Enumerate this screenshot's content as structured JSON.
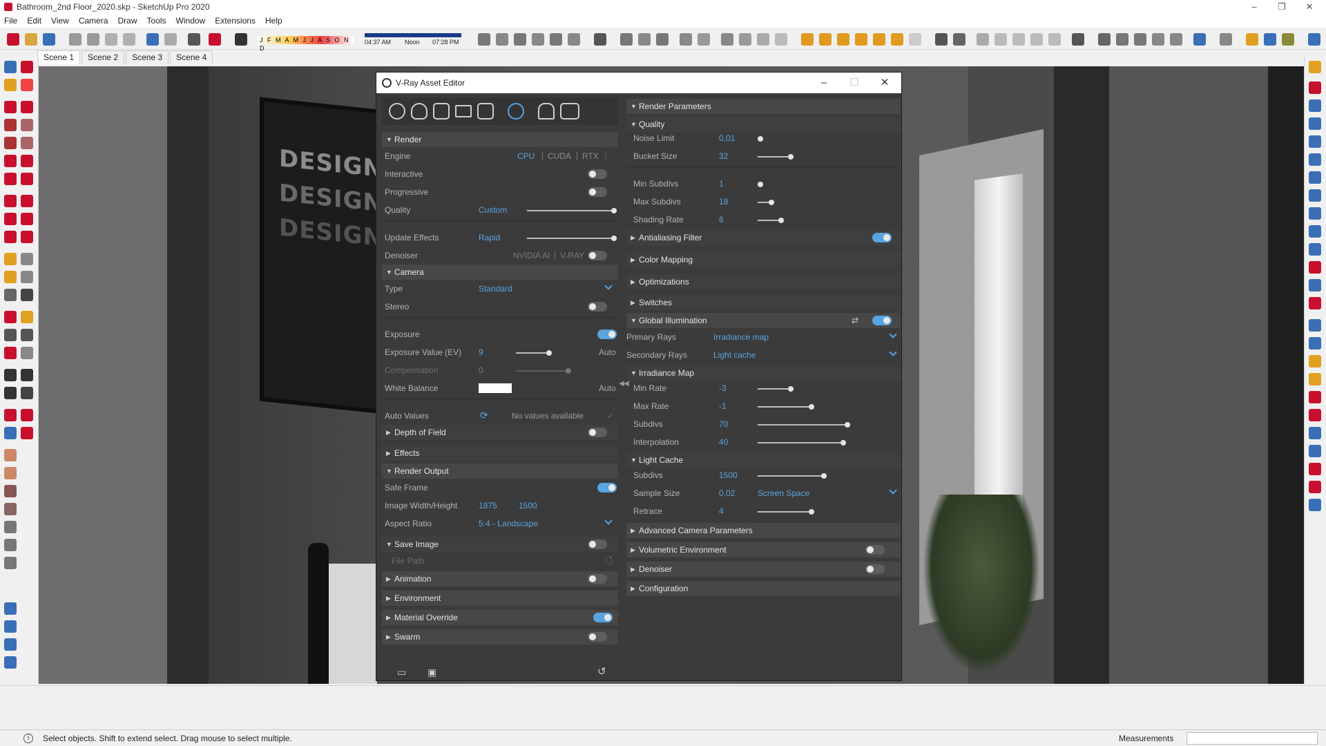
{
  "window": {
    "title": "Bathroom_2nd Floor_2020.skp - SketchUp Pro 2020"
  },
  "menu": [
    "File",
    "Edit",
    "View",
    "Camera",
    "Draw",
    "Tools",
    "Window",
    "Extensions",
    "Help"
  ],
  "shadow_bar": {
    "months": "J F M A M J J A S O N D",
    "time_start": "04:37 AM",
    "time_noon": "Noon",
    "time_end": "07:28 PM"
  },
  "scenes": [
    "Scene 1",
    "Scene 2",
    "Scene 3",
    "Scene 4"
  ],
  "viewport": {
    "poster_lines": [
      "DESIGN",
      "DESIGN",
      "DESIGN."
    ]
  },
  "status": {
    "info_icon": "i",
    "text": "Select objects. Shift to extend select. Drag mouse to select multiple.",
    "measurements_label": "Measurements"
  },
  "vray": {
    "title": "V-Ray Asset Editor",
    "render": {
      "header": "Render",
      "engine_label": "Engine",
      "engine_options": [
        "CPU",
        "CUDA",
        "RTX"
      ],
      "interactive_label": "Interactive",
      "interactive_on": false,
      "progressive_label": "Progressive",
      "progressive_on": false,
      "quality_label": "Quality",
      "quality_value": "Custom",
      "quality_fraction": 1.0,
      "update_effects_label": "Update Effects",
      "update_effects_value": "Rapid",
      "update_effects_fraction": 1.0,
      "denoiser_label": "Denoiser",
      "denoiser_nvidia": "NVIDIA AI",
      "denoiser_vray": "V-RAY",
      "denoiser_on": false
    },
    "camera": {
      "header": "Camera",
      "type_label": "Type",
      "type_value": "Standard",
      "stereo_label": "Stereo",
      "stereo_on": false,
      "exposure_label": "Exposure",
      "exposure_on": true,
      "ev_label": "Exposure Value (EV)",
      "ev_value": "9",
      "ev_auto": "Auto",
      "comp_label": "Compensation",
      "comp_value": "0",
      "wb_label": "White Balance",
      "wb_auto": "Auto",
      "wb_color": "#ffffff",
      "auto_values_label": "Auto Values",
      "auto_values_text": "No values available"
    },
    "dof_header": "Depth of Field",
    "effects_header": "Effects",
    "render_output": {
      "header": "Render Output",
      "safe_frame_label": "Safe Frame",
      "safe_frame_on": true,
      "size_label": "Image Width/Height",
      "width": "1875",
      "height": "1500",
      "aspect_label": "Aspect Ratio",
      "aspect_value": "5:4 - Landscape"
    },
    "save_image": {
      "header": "Save Image",
      "file_path_label": "File Path"
    },
    "animation_header": "Animation",
    "environment_header": "Environment",
    "material_override_header": "Material Override",
    "swarm_header": "Swarm",
    "render_parameters": {
      "header": "Render Parameters",
      "quality_header": "Quality",
      "noise_limit_label": "Noise Limit",
      "noise_limit_value": "0,01",
      "bucket_size_label": "Bucket Size",
      "bucket_size_value": "32",
      "min_subdivs_label": "Min Subdivs",
      "min_subdivs_value": "1",
      "max_subdivs_label": "Max Subdivs",
      "max_subdivs_value": "18",
      "shading_rate_label": "Shading Rate",
      "shading_rate_value": "6",
      "aa_filter_header": "Antialiasing Filter",
      "color_mapping_header": "Color Mapping",
      "optimizations_header": "Optimizations",
      "switches_header": "Switches",
      "gi_header": "Global Illumination",
      "primary_rays_label": "Primary Rays",
      "primary_rays_value": "Irradiance map",
      "secondary_rays_label": "Secondary Rays",
      "secondary_rays_value": "Light cache",
      "irr_map_header": "Irradiance Map",
      "min_rate_label": "Min Rate",
      "min_rate_value": "-3",
      "max_rate_label": "Max Rate",
      "max_rate_value": "-1",
      "subdivs_label": "Subdivs",
      "subdivs_value": "70",
      "interp_label": "Interpolation",
      "interp_value": "40",
      "light_cache_header": "Light Cache",
      "lc_subdivs_label": "Subdivs",
      "lc_subdivs_value": "1500",
      "sample_size_label": "Sample Size",
      "sample_size_value": "0,02",
      "sample_space_value": "Screen Space",
      "retrace_label": "Retrace",
      "retrace_value": "4",
      "adv_camera_header": "Advanced Camera Parameters",
      "vol_env_header": "Volumetric Environment",
      "denoiser_header": "Denoiser",
      "configuration_header": "Configuration"
    }
  },
  "colors": {
    "accent": "#5aa4e0",
    "panel_bg": "#3b3b3b",
    "section_bg": "#474747"
  }
}
